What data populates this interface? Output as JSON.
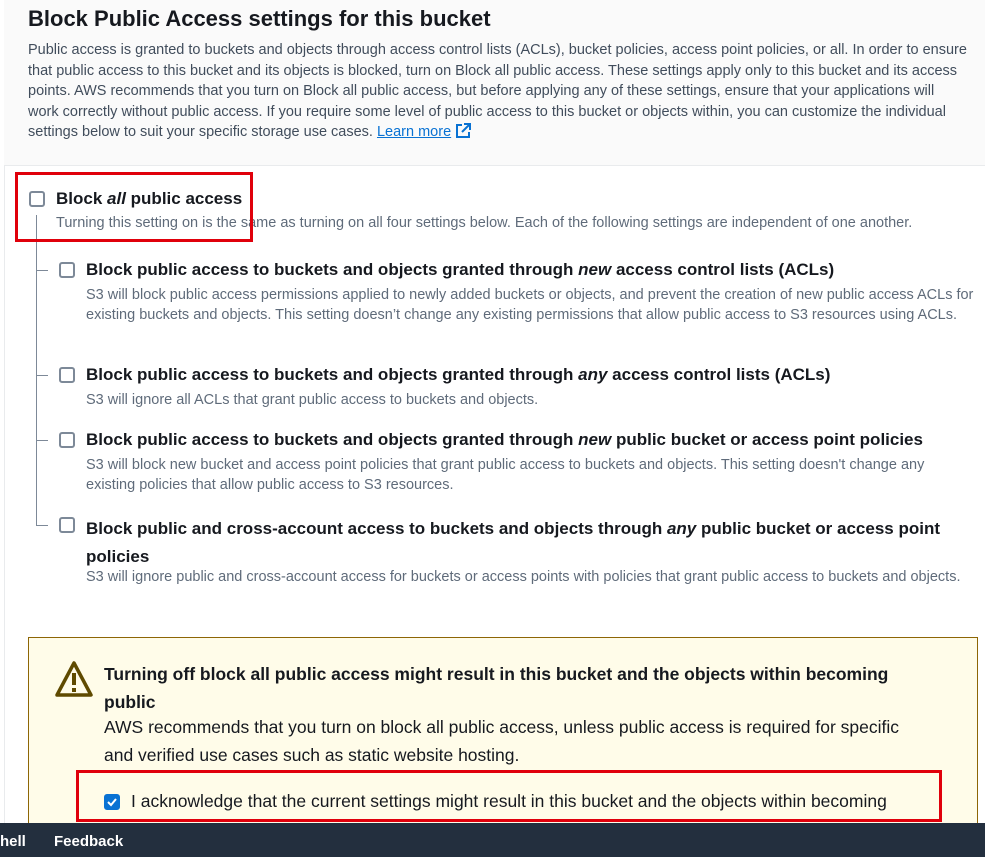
{
  "header": {
    "title": "Block Public Access settings for this bucket",
    "description": "Public access is granted to buckets and objects through access control lists (ACLs), bucket policies, access point policies, or all. In order to ensure that public access to this bucket and its objects is blocked, turn on Block all public access. These settings apply only to this bucket and its access points. AWS recommends that you turn on Block all public access, but before applying any of these settings, ensure that your applications will work correctly without public access. If you require some level of public access to this bucket or objects within, you can customize the individual settings below to suit your specific storage use cases.",
    "learn_more": "Learn more"
  },
  "block_all": {
    "title_pre": "Block ",
    "title_em": "all",
    "title_post": " public access",
    "description": "Turning this setting on is the same as turning on all four settings below. Each of the following settings are independent of one another.",
    "checked": false
  },
  "options": [
    {
      "title_pre": "Block public access to buckets and objects granted through ",
      "title_em": "new",
      "title_post": " access control lists (ACLs)",
      "description": "S3 will block public access permissions applied to newly added buckets or objects, and prevent the creation of new public access ACLs for existing buckets and objects. This setting doesn’t change any existing permissions that allow public access to S3 resources using ACLs.",
      "checked": false
    },
    {
      "title_pre": "Block public access to buckets and objects granted through ",
      "title_em": "any",
      "title_post": " access control lists (ACLs)",
      "description": "S3 will ignore all ACLs that grant public access to buckets and objects.",
      "checked": false
    },
    {
      "title_pre": "Block public access to buckets and objects granted through ",
      "title_em": "new",
      "title_post": " public bucket or access point policies",
      "description": "S3 will block new bucket and access point policies that grant public access to buckets and objects. This setting doesn't change any existing policies that allow public access to S3 resources.",
      "checked": false
    },
    {
      "title_pre": "Block public and cross-account access to buckets and objects through ",
      "title_em": "any",
      "title_post": " public bucket or access point policies",
      "description": "S3 will ignore public and cross-account access for buckets or access points with policies that grant public access to buckets and objects.",
      "checked": false
    }
  ],
  "warning": {
    "title": "Turning off block all public access might result in this bucket and the objects within becoming public",
    "description": "AWS recommends that you turn on block all public access, unless public access is required for specific and verified use cases such as static website hosting.",
    "acknowledge": "I acknowledge that the current settings might result in this bucket and the objects within becoming",
    "acknowledge_checked": true,
    "icon": "warning-triangle-icon"
  },
  "footer": {
    "cloudshell": "hell",
    "feedback": "Feedback"
  },
  "colors": {
    "accent": "#0972d3",
    "highlight": "#e0000b",
    "warning_bg": "#fffce9",
    "footer_bg": "#232f3e"
  }
}
